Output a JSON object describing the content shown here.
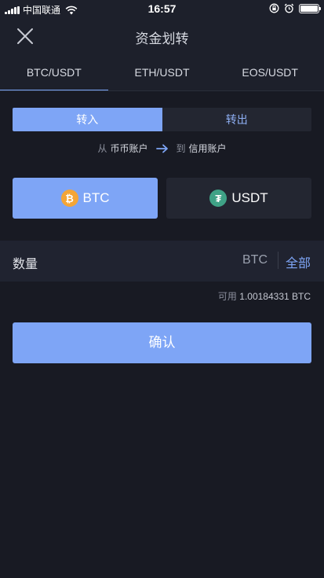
{
  "status_bar": {
    "carrier": "中国联通",
    "time": "16:57"
  },
  "nav": {
    "title": "资金划转",
    "close_icon": "close-icon"
  },
  "tabs": [
    {
      "label": "BTC/USDT",
      "active": true
    },
    {
      "label": "ETH/USDT",
      "active": false
    },
    {
      "label": "EOS/USDT",
      "active": false
    }
  ],
  "direction": {
    "in_label": "转入",
    "out_label": "转出",
    "selected": "in"
  },
  "flow": {
    "from_prefix": "从",
    "from_account": "币币账户",
    "to_prefix": "到",
    "to_account": "信用账户"
  },
  "coins": [
    {
      "symbol": "BTC",
      "icon": "bitcoin-icon",
      "icon_glyph": "₿",
      "color": "#f4a536",
      "selected": true
    },
    {
      "symbol": "USDT",
      "icon": "tether-icon",
      "icon_glyph": "₮",
      "color": "#3fa286",
      "selected": false
    }
  ],
  "quantity": {
    "label": "数量",
    "value": "",
    "unit": "BTC",
    "all_label": "全部"
  },
  "available": {
    "prefix": "可用",
    "amount": "1.00184331 BTC"
  },
  "confirm_label": "确认",
  "colors": {
    "accent": "#7ea5f6",
    "background": "#181a23",
    "panel": "#1d202b"
  }
}
